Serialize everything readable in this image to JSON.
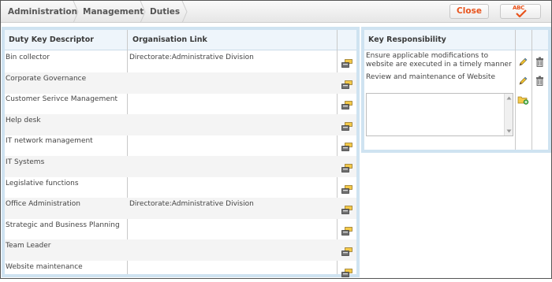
{
  "breadcrumb": [
    "Administration",
    "Management",
    "Duties"
  ],
  "toolbar": {
    "close_label": "Close",
    "spell_label": "ABC"
  },
  "duties_table": {
    "headers": [
      "Duty Key Descriptor",
      "Organisation Link"
    ],
    "rows": [
      {
        "descriptor": "Bin collector",
        "org": "Directorate:Administrative Division"
      },
      {
        "descriptor": "Corporate Governance",
        "org": ""
      },
      {
        "descriptor": "Customer Serivce Management",
        "org": ""
      },
      {
        "descriptor": "Help desk",
        "org": ""
      },
      {
        "descriptor": "IT network management",
        "org": ""
      },
      {
        "descriptor": "IT Systems",
        "org": ""
      },
      {
        "descriptor": "Legislative functions",
        "org": ""
      },
      {
        "descriptor": "Office Administration",
        "org": "Directorate:Administrative Division"
      },
      {
        "descriptor": "Strategic and Business Planning",
        "org": ""
      },
      {
        "descriptor": "Team Leader",
        "org": ""
      },
      {
        "descriptor": "Website maintenance",
        "org": ""
      }
    ]
  },
  "responsibility_table": {
    "header": "Key Responsibility",
    "rows": [
      {
        "text": "Ensure applicable modifications to website are executed in a timely manner"
      },
      {
        "text": "Review and maintenance of Website"
      }
    ],
    "new_entry_value": ""
  },
  "colors": {
    "panel_border": "#cfe3f1",
    "header_bg": "#eef5fb",
    "close_text": "#e8531c"
  },
  "icons": [
    "link-icon",
    "edit-pencil-icon",
    "trash-icon",
    "add-folder-icon",
    "spellcheck-icon"
  ]
}
